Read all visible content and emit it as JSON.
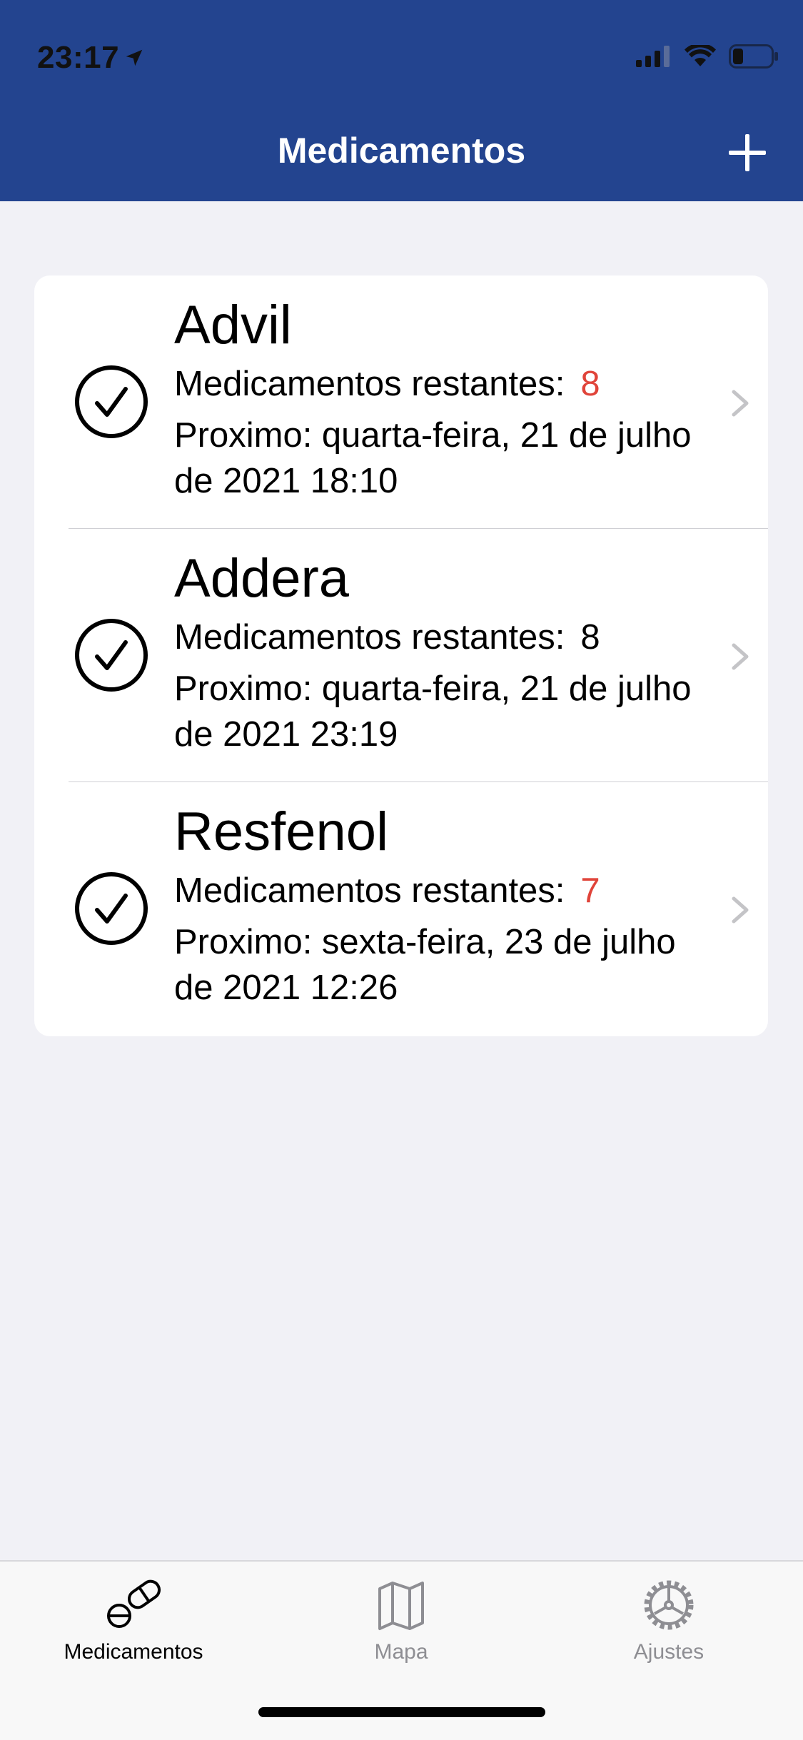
{
  "status_bar": {
    "time": "23:17",
    "location_icon": "location-arrow-icon",
    "signal_icon": "cellular-signal-icon",
    "wifi_icon": "wifi-icon",
    "battery_icon": "battery-low-icon"
  },
  "nav": {
    "title": "Medicamentos",
    "add_icon": "plus-icon"
  },
  "colors": {
    "header_bg": "#23448f",
    "accent_red": "#e0443a",
    "tab_active": "#000000",
    "tab_inactive": "#8e8e93"
  },
  "medications": [
    {
      "name": "Advil",
      "remaining_label": "Medicamentos restantes:",
      "remaining_count": "8",
      "remaining_color": "#e0443a",
      "next_line1": "Proximo: quarta-feira, 21 de julho",
      "next_line2": "de 2021 18:10",
      "status_icon": "checkmark-circle-icon"
    },
    {
      "name": "Addera",
      "remaining_label": "Medicamentos restantes:",
      "remaining_count": "8",
      "remaining_color": "#000000",
      "next_line1": "Proximo: quarta-feira, 21 de julho",
      "next_line2": "de 2021 23:19",
      "status_icon": "checkmark-circle-icon"
    },
    {
      "name": "Resfenol",
      "remaining_label": "Medicamentos restantes:",
      "remaining_count": "7",
      "remaining_color": "#e0443a",
      "next_line1": "Proximo: sexta-feira, 23 de julho",
      "next_line2": "de 2021 12:26",
      "status_icon": "checkmark-circle-icon"
    }
  ],
  "tabbar": {
    "tabs": [
      {
        "label": "Medicamentos",
        "icon": "pills-icon",
        "active": true
      },
      {
        "label": "Mapa",
        "icon": "map-icon",
        "active": false
      },
      {
        "label": "Ajustes",
        "icon": "gear-icon",
        "active": false
      }
    ]
  }
}
